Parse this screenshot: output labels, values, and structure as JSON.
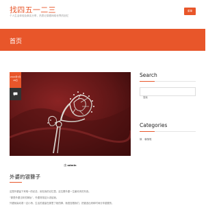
{
  "header": {
    "site_title": "找四五一二三",
    "site_description": "个人生活体验及事实分享，热衷记录跟网络世界的回忆",
    "menu_button": "菜单"
  },
  "banner": {
    "title": "首页"
  },
  "post": {
    "date": [
      "2024年7月",
      "28日"
    ],
    "comment_icon": "comment-icon",
    "image_description": "silver-flower-hairpin-photo",
    "byline_prefix": "由 ",
    "author": "admin",
    "title": "外婆的银簪子",
    "excerpt": [
      "这是外婆留下来唯一的纪念，用在我的记忆里。这位置外婆一生最珍贵的东西。",
      "“那是外婆当年的嫁妆”，外婆常常这么说给我。",
      "外婆就喜欢着一边小桥，生活的重量在那里了她的脚，她语言跟我们，把被选出来和时间分享重要的，"
    ]
  },
  "sidebar": {
    "search_title": "Search",
    "search_placeholder": "搜索",
    "categories_title": "Categories",
    "categories": [
      "故　事随笔"
    ]
  },
  "colors": {
    "accent": "#e8562a",
    "dark": "#333333"
  }
}
